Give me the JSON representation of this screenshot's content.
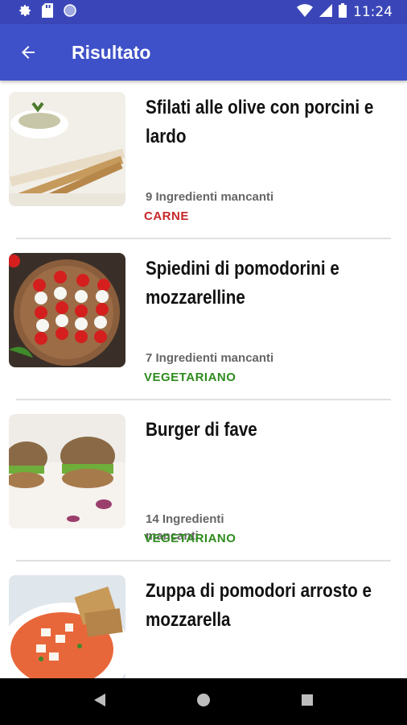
{
  "status_bar": {
    "time": "11:24"
  },
  "app_bar": {
    "title": "Risultato"
  },
  "recipes": [
    {
      "title": "Sfilati alle olive con porcini e lardo",
      "missing": "9 Ingredienti mancanti",
      "category": "CARNE",
      "category_color": "#c62828"
    },
    {
      "title": "Spiedini di pomodorini e mozzarelline",
      "missing": "7 Ingredienti mancanti",
      "category": "VEGETARIANO",
      "category_color": "#2e8b1e"
    },
    {
      "title": "Burger di fave",
      "missing": "14 Ingredienti mancanti",
      "category": "VEGETARIANO",
      "category_color": "#2e8b1e"
    },
    {
      "title": "Zuppa di pomodori arrosto e mozzarella",
      "missing": "",
      "category": "",
      "category_color": "#2e8b1e"
    }
  ],
  "colors": {
    "status_bar": "#3a46b8",
    "app_bar": "#3f51c8"
  }
}
